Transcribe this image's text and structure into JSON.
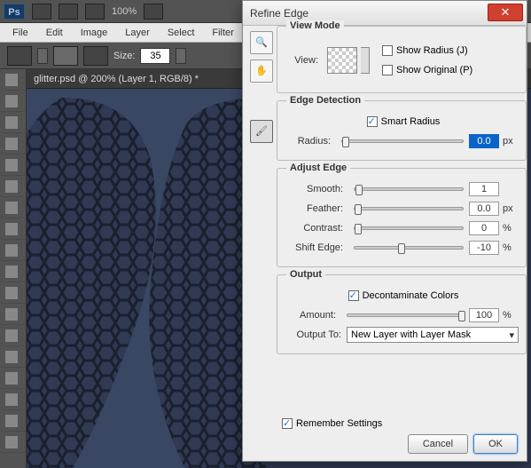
{
  "topbar": {
    "logo": "Ps",
    "zoom": "100%"
  },
  "menu": [
    "File",
    "Edit",
    "Image",
    "Layer",
    "Select",
    "Filter"
  ],
  "options": {
    "size_label": "Size:",
    "size_value": "35"
  },
  "doc": {
    "tab": "glitter.psd @ 200% (Layer 1, RGB/8) *"
  },
  "dialog": {
    "title": "Refine Edge",
    "view_mode": {
      "title": "View Mode",
      "view_label": "View:",
      "show_radius": "Show Radius (J)",
      "show_original": "Show Original (P)"
    },
    "edge": {
      "title": "Edge Detection",
      "smart": "Smart Radius",
      "radius_label": "Radius:",
      "radius_value": "0.0",
      "radius_unit": "px"
    },
    "adjust": {
      "title": "Adjust Edge",
      "smooth": {
        "label": "Smooth:",
        "value": "1",
        "unit": ""
      },
      "feather": {
        "label": "Feather:",
        "value": "0.0",
        "unit": "px"
      },
      "contrast": {
        "label": "Contrast:",
        "value": "0",
        "unit": "%"
      },
      "shift": {
        "label": "Shift Edge:",
        "value": "-10",
        "unit": "%"
      }
    },
    "output": {
      "title": "Output",
      "decon": "Decontaminate Colors",
      "amount_label": "Amount:",
      "amount_value": "100",
      "amount_unit": "%",
      "to_label": "Output To:",
      "to_value": "New Layer with Layer Mask"
    },
    "remember": "Remember Settings",
    "cancel": "Cancel",
    "ok": "OK"
  }
}
